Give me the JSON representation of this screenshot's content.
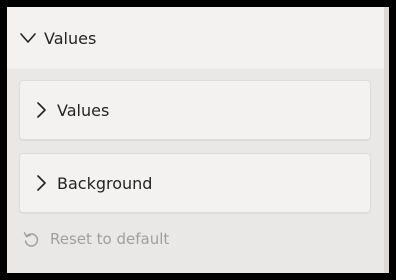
{
  "section": {
    "title": "Values",
    "expanded": true,
    "chevron_icon": "chevron-down-icon"
  },
  "cards": [
    {
      "label": "Values",
      "expanded": false,
      "chevron_icon": "chevron-right-icon"
    },
    {
      "label": "Background",
      "expanded": false,
      "chevron_icon": "chevron-right-icon"
    }
  ],
  "reset": {
    "label": "Reset to default",
    "icon": "undo-icon",
    "enabled": false
  },
  "colors": {
    "header_bg": "#f3f2f1",
    "body_bg": "#e9e8e6",
    "text": "#252423",
    "disabled_text": "#a19f9d",
    "frame": "#000000"
  }
}
